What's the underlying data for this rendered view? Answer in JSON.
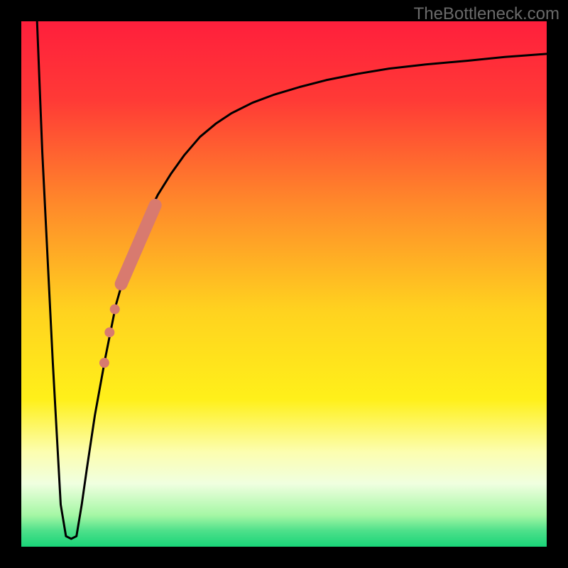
{
  "watermark": "TheBottleneck.com",
  "chart_data": {
    "type": "line",
    "title": "",
    "xlabel": "",
    "ylabel": "",
    "xlim": [
      0,
      100
    ],
    "ylim": [
      0,
      100
    ],
    "gradient_stops": [
      {
        "offset": 0.0,
        "color": "#ff1f3c"
      },
      {
        "offset": 0.15,
        "color": "#ff3a36"
      },
      {
        "offset": 0.35,
        "color": "#ff8a2a"
      },
      {
        "offset": 0.55,
        "color": "#ffd21f"
      },
      {
        "offset": 0.72,
        "color": "#fff01a"
      },
      {
        "offset": 0.82,
        "color": "#fcfeb0"
      },
      {
        "offset": 0.88,
        "color": "#f0ffe0"
      },
      {
        "offset": 0.94,
        "color": "#a5f7a5"
      },
      {
        "offset": 0.97,
        "color": "#4de08a"
      },
      {
        "offset": 1.0,
        "color": "#19d478"
      }
    ],
    "series": [
      {
        "name": "bottleneck-curve",
        "color": "#000000",
        "x": [
          3.0,
          4.0,
          6.0,
          7.5,
          8.5,
          9.5,
          10.5,
          11.5,
          12.5,
          14.0,
          16.0,
          18.0,
          20.0,
          22.0,
          24.0,
          26.0,
          28.5,
          31.0,
          34.0,
          37.0,
          40.0,
          44.0,
          48.0,
          53.0,
          58.0,
          64.0,
          70.0,
          77.0,
          85.0,
          92.0,
          100.0
        ],
        "y": [
          100.0,
          75.0,
          35.0,
          8.0,
          2.0,
          1.5,
          2.0,
          8.0,
          15.0,
          25.0,
          36.0,
          46.0,
          53.0,
          58.0,
          63.0,
          67.0,
          71.0,
          74.5,
          78.0,
          80.5,
          82.5,
          84.5,
          86.0,
          87.5,
          88.8,
          90.0,
          91.0,
          91.8,
          92.5,
          93.2,
          93.8
        ]
      }
    ],
    "overlay_band": {
      "name": "highlight-band",
      "color": "#d87a6f",
      "thick_segment": {
        "x1": 19.0,
        "y1": 50.0,
        "x2": 25.5,
        "y2": 65.0,
        "width": 18
      },
      "dots": [
        {
          "x": 17.8,
          "y": 45.2,
          "r": 7
        },
        {
          "x": 16.8,
          "y": 40.8,
          "r": 7
        },
        {
          "x": 15.8,
          "y": 35.0,
          "r": 7
        }
      ]
    },
    "frame": {
      "outer": 800,
      "border": 30
    }
  }
}
